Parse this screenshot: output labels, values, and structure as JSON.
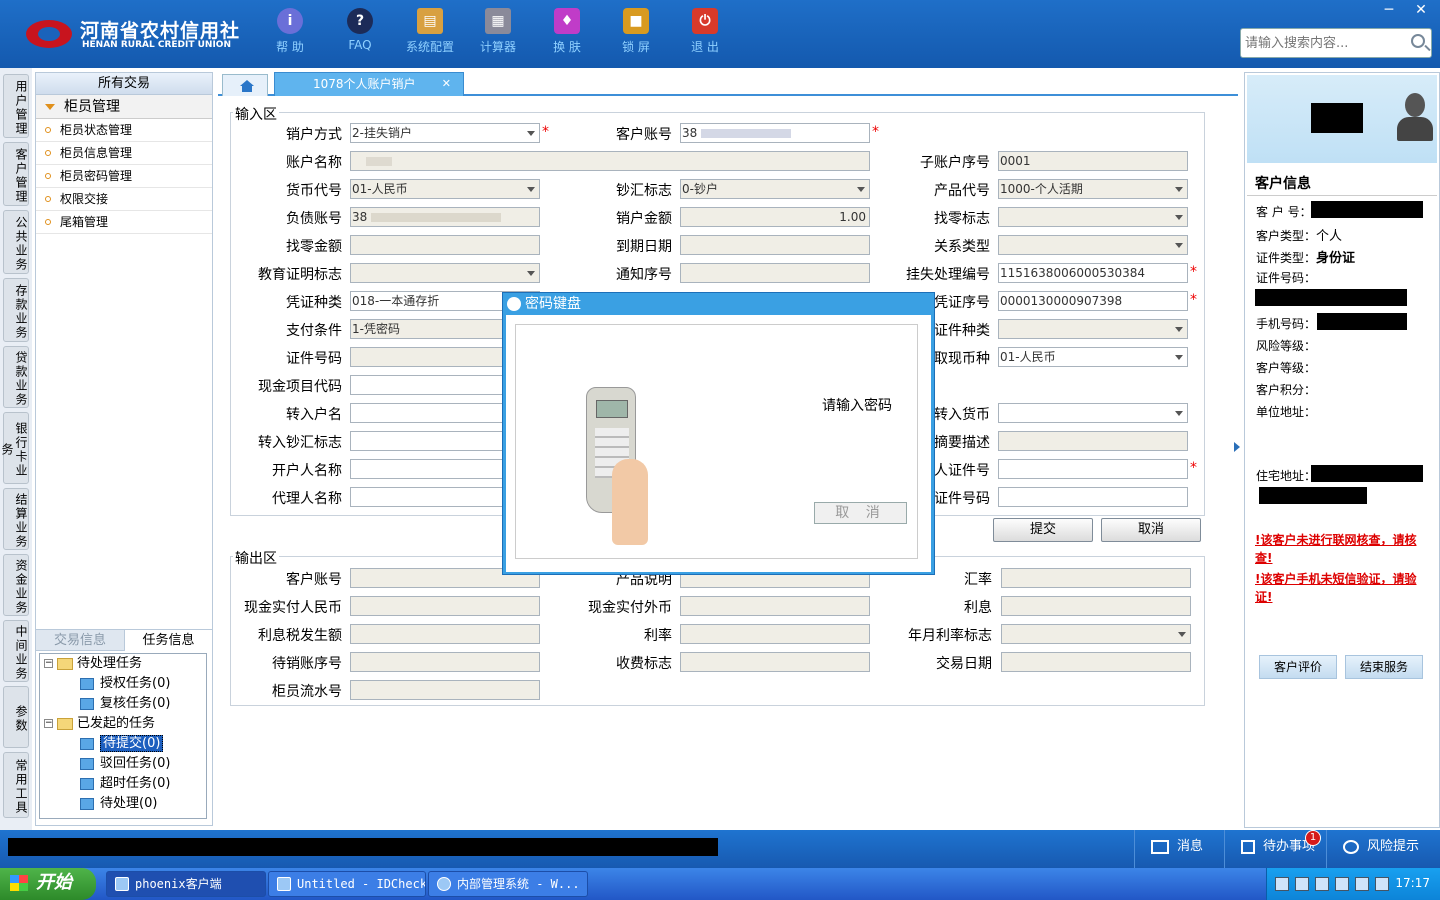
{
  "header": {
    "logo_cn": "河南省农村信用社",
    "logo_en": "HENAN RURAL CREDIT UNION",
    "toolbar": [
      {
        "label": "帮 助",
        "icon": "info-icon",
        "glyph": "i",
        "color": "#6a6fd8"
      },
      {
        "label": "FAQ",
        "icon": "question-icon",
        "glyph": "?",
        "color": "#1c2b58"
      },
      {
        "label": "系统配置",
        "icon": "toolbox-icon",
        "glyph": "▤",
        "color": "#d8a040"
      },
      {
        "label": "计算器",
        "icon": "calculator-icon",
        "glyph": "▦",
        "color": "#8a8a9a"
      },
      {
        "label": "换 肤",
        "icon": "shirt-icon",
        "glyph": "♦",
        "color": "#c03cc8"
      },
      {
        "label": "锁 屏",
        "icon": "lock-icon",
        "glyph": "■",
        "color": "#d89a20"
      },
      {
        "label": "退 出",
        "icon": "power-icon",
        "glyph": "⏻",
        "color": "#d83a2a"
      }
    ],
    "search_placeholder": "请输入搜索内容...",
    "min_glyph": "─",
    "close_glyph": "✕"
  },
  "vnav": [
    "用户管理",
    "客户管理",
    "公共业务",
    "存款业务",
    "贷款业务",
    "银行卡业务",
    "结算业务",
    "资金业务",
    "中间业务",
    "参数",
    "常用工具"
  ],
  "left_panel": {
    "title": "所有交易",
    "group": "柜员管理",
    "items": [
      "柜员状态管理",
      "柜员信息管理",
      "柜员密码管理",
      "权限交接",
      "尾箱管理"
    ],
    "tabs": [
      "交易信息",
      "任务信息"
    ],
    "tree": {
      "pending": "待处理任务",
      "pending_children": [
        "授权任务(0)",
        "复核任务(0)"
      ],
      "initiated": "已发起的任务",
      "initiated_children": [
        "待提交(0)",
        "驳回任务(0)",
        "超时任务(0)",
        "待处理(0)"
      ]
    }
  },
  "tabs": {
    "active": "1078个人账户销户",
    "close_glyph": "✕"
  },
  "input_area": {
    "title": "输入区",
    "fields": {
      "close_method": {
        "label": "销户方式",
        "value": "2-挂失销户"
      },
      "customer_account": {
        "label": "客户账号",
        "value": "38"
      },
      "account_name": {
        "label": "账户名称",
        "value": ""
      },
      "sub_account_no": {
        "label": "子账户序号",
        "value": "0001"
      },
      "currency": {
        "label": "货币代号",
        "value": "01-人民币"
      },
      "cash_flag": {
        "label": "钞汇标志",
        "value": "0-钞户"
      },
      "product_code": {
        "label": "产品代号",
        "value": "1000-个人活期"
      },
      "debt_account": {
        "label": "负债账号",
        "value": "38"
      },
      "close_amount": {
        "label": "销户金额",
        "value": "1.00"
      },
      "change_flag": {
        "label": "找零标志",
        "value": ""
      },
      "change_amount": {
        "label": "找零金额",
        "value": ""
      },
      "due_date": {
        "label": "到期日期",
        "value": ""
      },
      "relation_type": {
        "label": "关系类型",
        "value": ""
      },
      "edu_cert_flag": {
        "label": "教育证明标志",
        "value": ""
      },
      "notice_no": {
        "label": "通知序号",
        "value": ""
      },
      "loss_no": {
        "label": "挂失处理编号",
        "value": "1151638006000530384"
      },
      "voucher_type": {
        "label": "凭证种类",
        "value": "018-一本通存折"
      },
      "voucher_no": {
        "label": "凭证序号",
        "value": "0000130000907398"
      },
      "pay_condition": {
        "label": "支付条件",
        "value": "1-凭密码"
      },
      "cert_type": {
        "label": "证件种类",
        "value": ""
      },
      "cert_no": {
        "label": "证件号码",
        "value": ""
      },
      "withdraw_currency": {
        "label": "取现币种",
        "value": "01-人民币"
      },
      "cash_item_code": {
        "label": "现金项目代码",
        "value": ""
      },
      "transfer_name": {
        "label": "转入户名",
        "value": ""
      },
      "transfer_currency": {
        "label": "转入货币",
        "value": ""
      },
      "transfer_cash_flag": {
        "label": "转入钞汇标志",
        "value": ""
      },
      "summary_desc": {
        "label": "摘要描述",
        "value": ""
      },
      "opener_name": {
        "label": "开户人名称",
        "value": ""
      },
      "person_cert_no": {
        "label": "人证件号",
        "value": ""
      },
      "agent_name": {
        "label": "代理人名称",
        "value": ""
      },
      "cert_no2": {
        "label": "证件号码",
        "value": ""
      }
    },
    "required_mark": "*"
  },
  "buttons": {
    "submit": "提交",
    "cancel": "取消"
  },
  "output_area": {
    "title": "输出区",
    "fields": {
      "customer_account": {
        "label": "客户账号",
        "value": ""
      },
      "product_desc": {
        "label": "产品说明",
        "value": ""
      },
      "exchange_rate": {
        "label": "汇率",
        "value": ""
      },
      "cash_rmb": {
        "label": "现金实付人民币",
        "value": ""
      },
      "cash_foreign": {
        "label": "现金实付外币",
        "value": ""
      },
      "interest": {
        "label": "利息",
        "value": ""
      },
      "interest_tax": {
        "label": "利息税发生额",
        "value": ""
      },
      "rate": {
        "label": "利率",
        "value": ""
      },
      "rate_flag": {
        "label": "年月利率标志",
        "value": ""
      },
      "pending_seq": {
        "label": "待销账序号",
        "value": ""
      },
      "fee_flag": {
        "label": "收费标志",
        "value": ""
      },
      "txn_date": {
        "label": "交易日期",
        "value": ""
      },
      "teller_seq": {
        "label": "柜员流水号",
        "value": ""
      }
    }
  },
  "modal": {
    "title": "密码键盘",
    "message": "请输入密码",
    "cancel": "取 消"
  },
  "right_panel": {
    "title": "客户信息",
    "fields": {
      "customer_no": "客 户 号：",
      "customer_type_label": "客户类型：",
      "customer_type_value": "个人",
      "cert_type_label": "证件类型：",
      "cert_type_value": "身份证",
      "cert_no": "证件号码：",
      "mobile": "手机号码：",
      "risk_level": "风险等级：",
      "customer_level": "客户等级：",
      "points": "客户积分：",
      "work_address": "单位地址：",
      "home_address": "住宅地址："
    },
    "warnings": [
      "!该客户未进行联网核查，请核查!",
      "!该客户手机未短信验证，请验证!"
    ],
    "buttons": [
      "客户评价",
      "结束服务"
    ]
  },
  "status_bar": {
    "items": [
      {
        "label": "消息",
        "icon": "mail-icon"
      },
      {
        "label": "待办事项",
        "icon": "checkbox-icon"
      },
      {
        "label": "风险提示",
        "icon": "chat-icon"
      }
    ],
    "badge": "1"
  },
  "taskbar": {
    "start": "开始",
    "tasks": [
      "phoenix客户端",
      "Untitled - IDCheck",
      "内部管理系统 - W..."
    ],
    "clock": "17:17"
  }
}
